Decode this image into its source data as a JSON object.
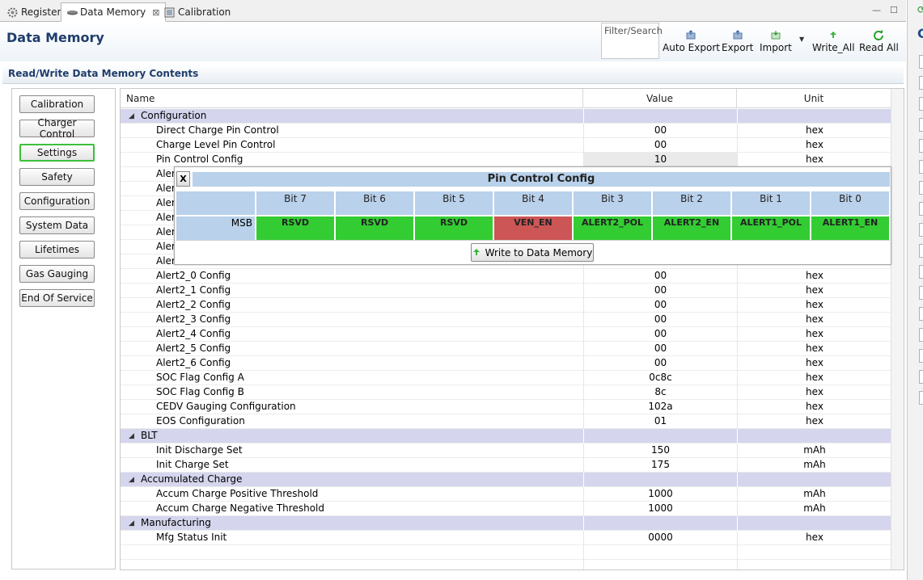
{
  "tabs": [
    {
      "label": "Registers",
      "icon": "gear-icon"
    },
    {
      "label": "Data Memory",
      "icon": "memory-icon",
      "close": "⊠"
    },
    {
      "label": "Calibration",
      "icon": "calibration-icon"
    }
  ],
  "window_controls": {
    "minimize": "—",
    "maximize": "☐"
  },
  "header": {
    "title": "Data Memory",
    "filter_placeholder": "Filter/Search",
    "buttons": [
      "Auto Export",
      "Export",
      "Import",
      "Write_All",
      "Read All"
    ]
  },
  "section": {
    "title": "Read/Write Data Memory Contents"
  },
  "nav": [
    "Calibration",
    "Charger Control",
    "Settings",
    "Safety",
    "Configuration",
    "System Data",
    "Lifetimes",
    "Gas Gauging",
    "End Of Service"
  ],
  "nav_selected": "Settings",
  "table": {
    "columns": [
      "Name",
      "Value",
      "Unit"
    ],
    "rows": [
      {
        "type": "group",
        "name": "Configuration"
      },
      {
        "type": "item",
        "name": "Direct Charge Pin Control",
        "value": "00",
        "unit": "hex"
      },
      {
        "type": "item",
        "name": "Charge Level Pin Control",
        "value": "00",
        "unit": "hex"
      },
      {
        "type": "item",
        "name": "Pin Control Config",
        "value": "10",
        "unit": "hex",
        "highlight": true
      },
      {
        "type": "item",
        "name": "Aler",
        "value": "",
        "unit": ""
      },
      {
        "type": "item",
        "name": "Aler",
        "value": "",
        "unit": ""
      },
      {
        "type": "item",
        "name": "Aler",
        "value": "",
        "unit": ""
      },
      {
        "type": "item",
        "name": "Aler",
        "value": "",
        "unit": ""
      },
      {
        "type": "item",
        "name": "Aler",
        "value": "",
        "unit": ""
      },
      {
        "type": "item",
        "name": "Aler",
        "value": "",
        "unit": ""
      },
      {
        "type": "item",
        "name": "Aler",
        "value": "",
        "unit": ""
      },
      {
        "type": "item",
        "name": "Alert2_0 Config",
        "value": "00",
        "unit": "hex"
      },
      {
        "type": "item",
        "name": "Alert2_1 Config",
        "value": "00",
        "unit": "hex"
      },
      {
        "type": "item",
        "name": "Alert2_2 Config",
        "value": "00",
        "unit": "hex"
      },
      {
        "type": "item",
        "name": "Alert2_3 Config",
        "value": "00",
        "unit": "hex"
      },
      {
        "type": "item",
        "name": "Alert2_4 Config",
        "value": "00",
        "unit": "hex"
      },
      {
        "type": "item",
        "name": "Alert2_5 Config",
        "value": "00",
        "unit": "hex"
      },
      {
        "type": "item",
        "name": "Alert2_6 Config",
        "value": "00",
        "unit": "hex"
      },
      {
        "type": "item",
        "name": "SOC Flag Config A",
        "value": "0c8c",
        "unit": "hex"
      },
      {
        "type": "item",
        "name": "SOC Flag Config B",
        "value": "8c",
        "unit": "hex"
      },
      {
        "type": "item",
        "name": "CEDV Gauging Configuration",
        "value": "102a",
        "unit": "hex"
      },
      {
        "type": "item",
        "name": "EOS Configuration",
        "value": "01",
        "unit": "hex"
      },
      {
        "type": "group",
        "name": "BLT"
      },
      {
        "type": "item",
        "name": "Init Discharge Set",
        "value": "150",
        "unit": "mAh"
      },
      {
        "type": "item",
        "name": "Init Charge Set",
        "value": "175",
        "unit": "mAh"
      },
      {
        "type": "group",
        "name": "Accumulated Charge"
      },
      {
        "type": "item",
        "name": "Accum Charge Positive Threshold",
        "value": "1000",
        "unit": "mAh"
      },
      {
        "type": "item",
        "name": "Accum Charge Negative Threshold",
        "value": "1000",
        "unit": "mAh"
      },
      {
        "type": "group",
        "name": "Manufacturing"
      },
      {
        "type": "item",
        "name": "Mfg Status Init",
        "value": "0000",
        "unit": "hex"
      },
      {
        "type": "empty"
      },
      {
        "type": "empty"
      }
    ]
  },
  "popup": {
    "close_label": "X",
    "title": "Pin Control Config",
    "bit_headers": [
      "Bit 7",
      "Bit 6",
      "Bit 5",
      "Bit 4",
      "Bit 3",
      "Bit 2",
      "Bit 1",
      "Bit 0"
    ],
    "row_label": "MSB",
    "bits": [
      {
        "name": "RSVD",
        "state": "on"
      },
      {
        "name": "RSVD",
        "state": "on"
      },
      {
        "name": "RSVD",
        "state": "on"
      },
      {
        "name": "VEN_EN",
        "state": "off"
      },
      {
        "name": "ALERT2_POL",
        "state": "on"
      },
      {
        "name": "ALERT2_EN",
        "state": "on"
      },
      {
        "name": "ALERT1_POL",
        "state": "on"
      },
      {
        "name": "ALERT1_EN",
        "state": "on"
      }
    ],
    "write_label": "Write to Data Memory"
  },
  "colors": {
    "bit_on": "#33cc33",
    "bit_off": "#cc5555",
    "group_row": "#d5d5ee",
    "popup_header": "#b9d1ea",
    "title": "#1f3d6b"
  },
  "right_panel_letter": "C"
}
